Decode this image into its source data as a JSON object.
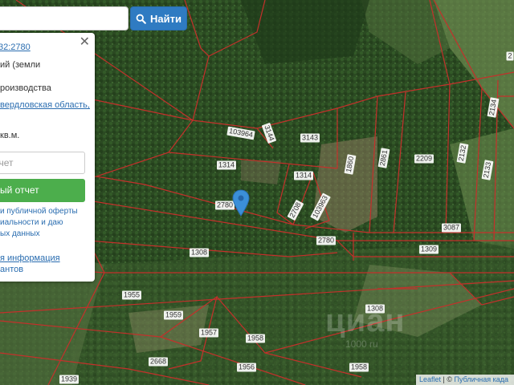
{
  "search": {
    "placeholder": "",
    "button_label": "Найти",
    "icon": "search-icon"
  },
  "panel": {
    "cadastral_link": "32:2780",
    "category_line1": "ий (земли",
    "category_line2": "роизводства",
    "address_link": "вердловская область,",
    "area": "кв.м.",
    "report_placeholder": "тчет",
    "order_button": "ый отчет",
    "terms_line1": "и публичной оферты",
    "terms_line2": "иальности и даю",
    "terms_line3": "ых данных",
    "info_link1": "я информация",
    "info_link2": "антов",
    "close_icon": "close-icon"
  },
  "map": {
    "plot_labels": [
      {
        "id": "l1",
        "text": "103964"
      },
      {
        "id": "l2",
        "text": "3144"
      },
      {
        "id": "l3",
        "text": "3143"
      },
      {
        "id": "l4",
        "text": "1314"
      },
      {
        "id": "l5",
        "text": "1314"
      },
      {
        "id": "l6",
        "text": "1860"
      },
      {
        "id": "l7",
        "text": "2861"
      },
      {
        "id": "l8",
        "text": "2209"
      },
      {
        "id": "l9",
        "text": "2132"
      },
      {
        "id": "l10",
        "text": "2133"
      },
      {
        "id": "l11",
        "text": "2134"
      },
      {
        "id": "l12",
        "text": "2780"
      },
      {
        "id": "l13",
        "text": "2708"
      },
      {
        "id": "l14",
        "text": "103963"
      },
      {
        "id": "l15",
        "text": "2780"
      },
      {
        "id": "l16",
        "text": "3087"
      },
      {
        "id": "l17",
        "text": "1308"
      },
      {
        "id": "l18",
        "text": "1309"
      },
      {
        "id": "l19",
        "text": "1955"
      },
      {
        "id": "l20",
        "text": "1959"
      },
      {
        "id": "l21",
        "text": "1957"
      },
      {
        "id": "l22",
        "text": "1958"
      },
      {
        "id": "l23",
        "text": "1308"
      },
      {
        "id": "l24",
        "text": "2668"
      },
      {
        "id": "l25",
        "text": "1956"
      },
      {
        "id": "l26",
        "text": "1958"
      },
      {
        "id": "l27",
        "text": "1939"
      },
      {
        "id": "l28",
        "text": "2"
      }
    ],
    "marker_icon": "map-pin-icon",
    "watermark": "циан",
    "watermark_sub": "1000 ru"
  },
  "attribution": {
    "leaflet": "Leaflet",
    "separator": " | © ",
    "source": "Публичная када"
  },
  "colors": {
    "boundary": "#c4302b",
    "button_blue": "#2f7bc2",
    "button_green": "#4cae4c",
    "link": "#2a6db0"
  }
}
